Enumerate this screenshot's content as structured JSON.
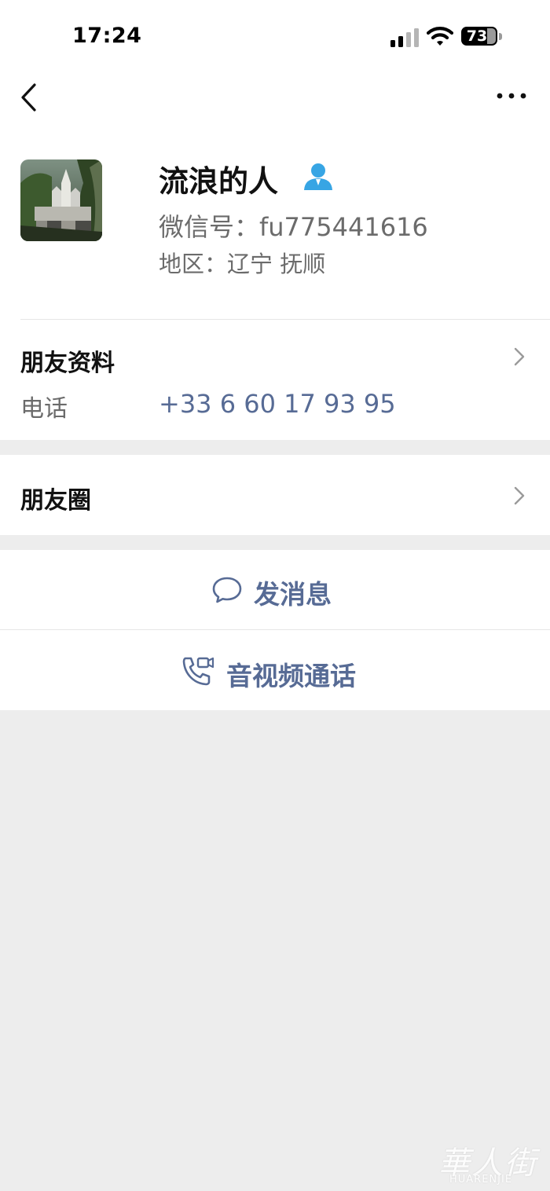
{
  "status_bar": {
    "time": "17:24",
    "battery": "73"
  },
  "profile": {
    "name": "流浪的人",
    "wechat_id": "微信号：fu775441616",
    "region": "地区：辽宁 抚顺"
  },
  "friend_info": {
    "title": "朋友资料",
    "phone_label": "电话",
    "phone_value": "+33 6 60 17 93 95"
  },
  "moments": {
    "title": "朋友圈"
  },
  "actions": {
    "message": "发消息",
    "call": "音视频通话"
  },
  "watermark": {
    "main": "華人街",
    "sub": "HUARENJIE"
  },
  "colors": {
    "link": "#576b95",
    "background": "#ededed"
  }
}
